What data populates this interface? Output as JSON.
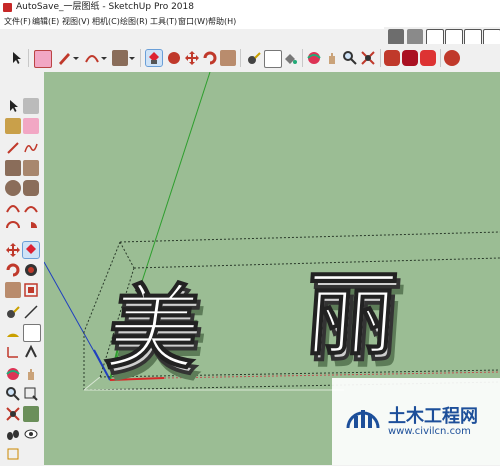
{
  "window": {
    "title": "AutoSave_一层图纸 - SketchUp Pro 2018"
  },
  "menu": [
    "文件(F)",
    "编辑(E)",
    "视图(V)",
    "相机(C)",
    "绘图(R)",
    "工具(T)",
    "窗口(W)",
    "帮助(H)"
  ],
  "model_text": [
    "美",
    "丽"
  ],
  "watermark": {
    "name": "土木工程网",
    "url": "www.civilcn.com"
  },
  "colors": {
    "sky": "#9bbd94",
    "ground": "#9bbd94",
    "axis_red": "#d62828",
    "axis_green": "#2e9e2e",
    "axis_blue": "#1f3fbf",
    "wm_blue": "#1d4f9a"
  },
  "toolbar_icons": [
    "select-icon",
    "eraser-icon",
    "pencil-icon",
    "arc-icon",
    "rectangle-icon",
    "push-pull-icon",
    "move-icon",
    "rotate-icon",
    "scale-icon",
    "offset-icon",
    "tape-measure-icon",
    "text-icon",
    "paint-bucket-icon",
    "orbit-icon",
    "pan-icon",
    "zoom-icon",
    "zoom-window-icon",
    "zoom-extents-icon",
    "warehouse-icon",
    "extension-icon",
    "sandbox-icon",
    "section-icon"
  ]
}
